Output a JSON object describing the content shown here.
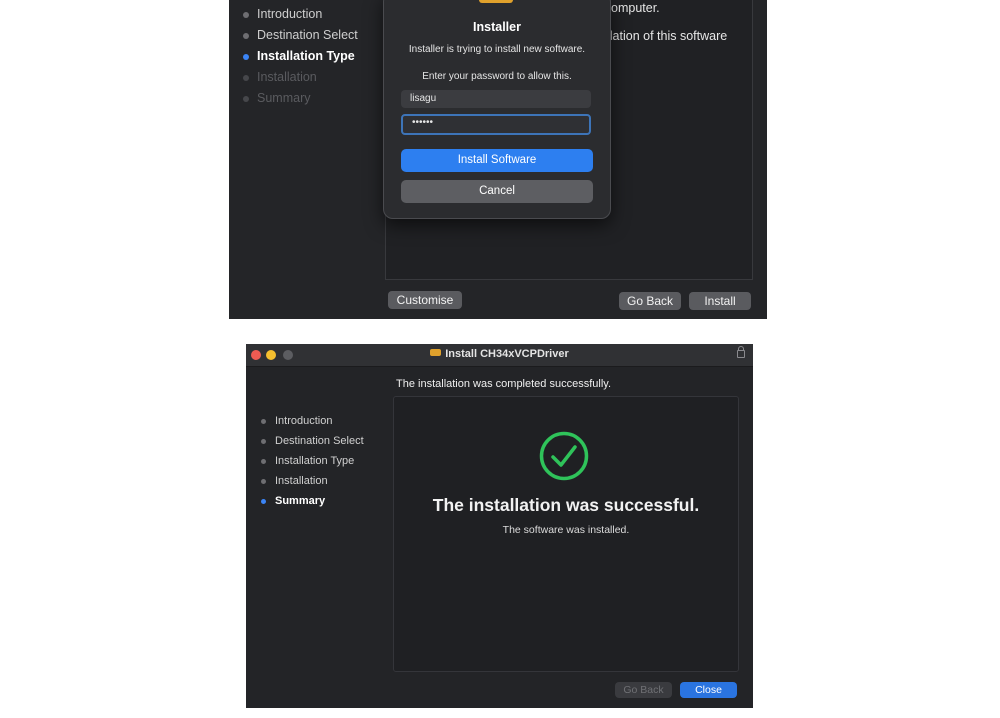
{
  "top": {
    "steps": [
      {
        "label": "Introduction",
        "state": "done"
      },
      {
        "label": "Destination Select",
        "state": "done"
      },
      {
        "label": "Installation Type",
        "state": "active"
      },
      {
        "label": "Installation",
        "state": "pending"
      },
      {
        "label": "Summary",
        "state": "pending"
      }
    ],
    "bg_text_line1": "omputer.",
    "bg_text_line2": "llation of this software",
    "buttons": {
      "customise": "Customise",
      "go_back": "Go Back",
      "install": "Install"
    },
    "dialog": {
      "title": "Installer",
      "message": "Installer is trying to install new software.",
      "prompt": "Enter your password to allow this.",
      "username": "lisagu",
      "password": "••••••",
      "install_software": "Install Software",
      "cancel": "Cancel"
    }
  },
  "bottom": {
    "window_title": "Install CH34xVCPDriver",
    "header": "The installation was completed successfully.",
    "steps": [
      {
        "label": "Introduction",
        "state": "done"
      },
      {
        "label": "Destination Select",
        "state": "done"
      },
      {
        "label": "Installation Type",
        "state": "done"
      },
      {
        "label": "Installation",
        "state": "done"
      },
      {
        "label": "Summary",
        "state": "active"
      }
    ],
    "success_title": "The installation was successful.",
    "success_subtitle": "The software was installed.",
    "buttons": {
      "go_back": "Go Back",
      "close": "Close"
    }
  },
  "colors": {
    "accent": "#3b84f5",
    "success": "#2fc35a",
    "traffic_red": "#ee5b52",
    "traffic_yellow": "#f5bf2f",
    "traffic_gray": "#5c5d61"
  },
  "icons": [
    "package-icon",
    "lock-icon",
    "success-checkmark-icon"
  ]
}
